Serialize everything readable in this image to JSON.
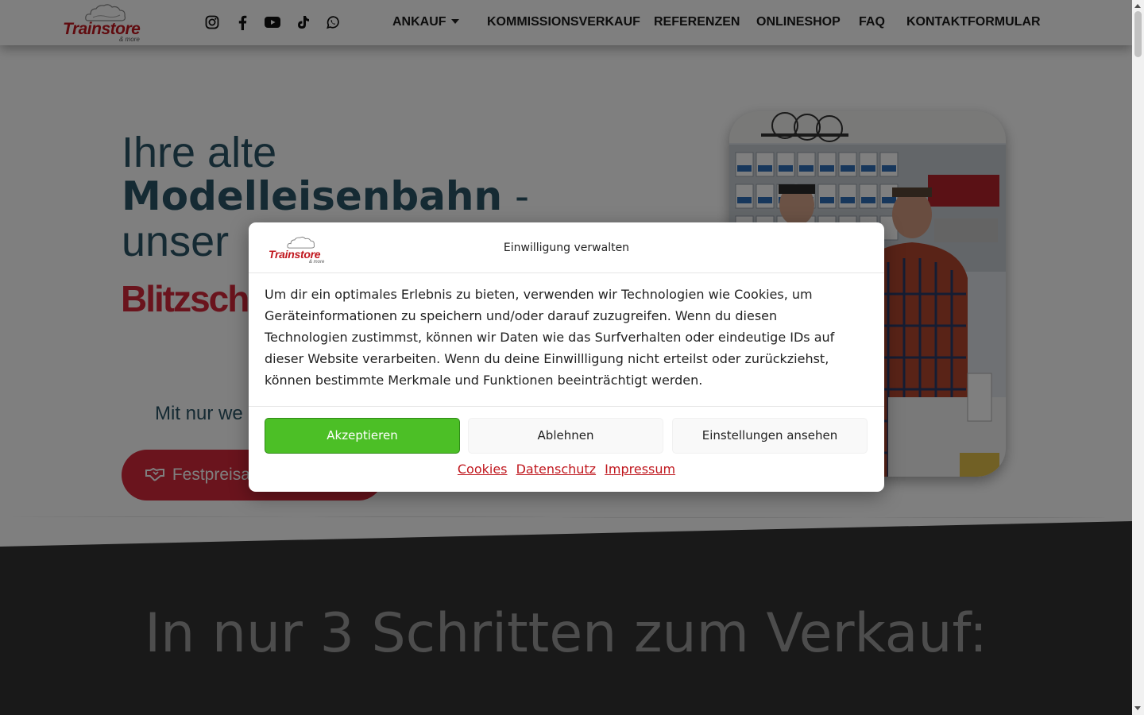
{
  "header": {
    "logo": {
      "brand": "Trainstore",
      "sub": "& more"
    },
    "social_icons": [
      "instagram-icon",
      "facebook-icon",
      "youtube-icon",
      "tiktok-icon",
      "whatsapp-icon"
    ],
    "nav": [
      {
        "label": "ANKAUF",
        "has_dropdown": true
      },
      {
        "label": "KOMMISSIONSVERKAUF"
      },
      {
        "label": "REFERENZEN"
      },
      {
        "label": "ONLINESHOP"
      },
      {
        "label": "FAQ"
      },
      {
        "label": "KONTAKTFORMULAR"
      }
    ]
  },
  "hero": {
    "line1": "Ihre alte",
    "line2_bold": "Modelleisenbahn",
    "line2_dash": " -",
    "line3": "unser",
    "highlight": "Blitzschr",
    "subtext": "Mit nur we",
    "button_label": "Festpreisa",
    "button_icon": "handshake-icon"
  },
  "section2": {
    "title": "In nur 3 Schritten zum Verkauf:"
  },
  "cookie_modal": {
    "logo": {
      "brand": "Trainstore",
      "sub": "& more"
    },
    "title": "Einwilligung verwalten",
    "text": "Um dir ein optimales Erlebnis zu bieten, verwenden wir Technologien wie Cookies, um Geräteinformationen zu speichern und/oder darauf zuzugreifen. Wenn du diesen Technologien zustimmst, können wir Daten wie das Surfverhalten oder eindeutige IDs auf dieser Website verarbeiten. Wenn du deine Einwillligung nicht erteilst oder zurückziehst, können bestimmte Merkmale und Funktionen beeinträchtigt werden.",
    "buttons": {
      "accept": "Akzeptieren",
      "deny": "Ablehnen",
      "settings": "Einstellungen ansehen"
    },
    "links": [
      "Cookies",
      "Datenschutz",
      "Impressum"
    ]
  },
  "colors": {
    "brand_red": "#c0171e",
    "hero_text": "#2a5566",
    "highlight_red": "#d4283a",
    "accept_green": "#4cbf26",
    "dark_section": "#333333"
  }
}
